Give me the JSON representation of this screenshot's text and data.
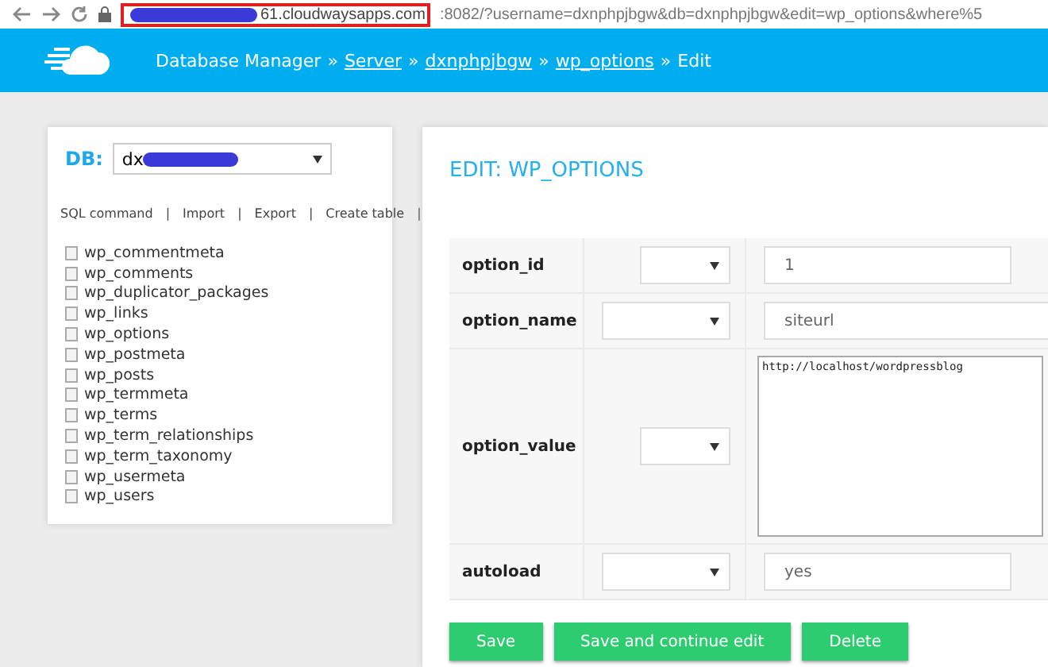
{
  "address_bar": {
    "host": "61.cloudwaysapps.com",
    "rest": ":8082/?username=dxnphpjbgw&db=dxnphpjbgw&edit=wp_options&where%5"
  },
  "header": {
    "breadcrumbs": [
      {
        "label": "Database Manager",
        "link": false
      },
      {
        "label": "Server",
        "link": true,
        "sep": "»"
      },
      {
        "label": "dxnphpjbgw",
        "link": true,
        "sep": "»"
      },
      {
        "label": "wp_options",
        "link": true,
        "sep": "»"
      },
      {
        "label": "Edit",
        "link": false,
        "sep": "»"
      }
    ]
  },
  "sidebar": {
    "db_label": "DB:",
    "db_value": "dx",
    "actions": [
      {
        "label": "SQL command",
        "sep": "|"
      },
      {
        "label": "Import",
        "sep": "|"
      },
      {
        "label": "Export",
        "sep": "|"
      },
      {
        "label": "Create table",
        "sep": "|"
      }
    ],
    "tables": [
      "wp_commentmeta",
      "wp_comments",
      "wp_duplicator_packages",
      "wp_links",
      "wp_options",
      "wp_postmeta",
      "wp_posts",
      "wp_termmeta",
      "wp_terms",
      "wp_term_relationships",
      "wp_term_taxonomy",
      "wp_usermeta",
      "wp_users"
    ]
  },
  "form": {
    "title": "EDIT: WP_OPTIONS",
    "fields": [
      {
        "name": "option_id",
        "kind": "input",
        "value": "1",
        "select_narrow": true
      },
      {
        "name": "option_name",
        "kind": "input",
        "value": "siteurl",
        "select_narrow": false,
        "wide": true
      },
      {
        "name": "option_value",
        "kind": "textarea",
        "value": "http://localhost/wordpressblog",
        "select_narrow": true
      },
      {
        "name": "autoload",
        "kind": "input",
        "value": "yes",
        "select_narrow": false
      }
    ],
    "buttons": [
      "Save",
      "Save and continue edit",
      "Delete"
    ]
  }
}
